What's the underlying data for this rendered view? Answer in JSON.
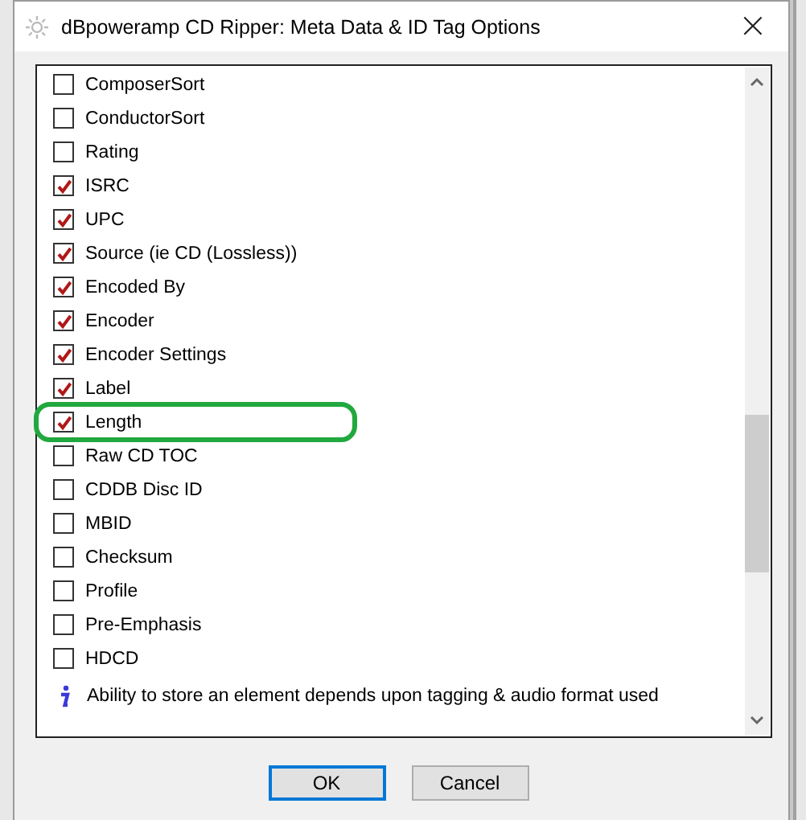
{
  "window": {
    "title": "dBpoweramp CD Ripper: Meta Data & ID Tag Options",
    "close": "×"
  },
  "items": [
    {
      "label": "ComposerSort",
      "checked": false,
      "highlighted": false
    },
    {
      "label": "ConductorSort",
      "checked": false,
      "highlighted": false
    },
    {
      "label": "Rating",
      "checked": false,
      "highlighted": false
    },
    {
      "label": "ISRC",
      "checked": true,
      "highlighted": false
    },
    {
      "label": "UPC",
      "checked": true,
      "highlighted": false
    },
    {
      "label": "Source (ie CD (Lossless))",
      "checked": true,
      "highlighted": false
    },
    {
      "label": "Encoded By",
      "checked": true,
      "highlighted": false
    },
    {
      "label": "Encoder",
      "checked": true,
      "highlighted": false
    },
    {
      "label": "Encoder Settings",
      "checked": true,
      "highlighted": false
    },
    {
      "label": "Label",
      "checked": true,
      "highlighted": false
    },
    {
      "label": "Length",
      "checked": true,
      "highlighted": true
    },
    {
      "label": "Raw CD TOC",
      "checked": false,
      "highlighted": false
    },
    {
      "label": "CDDB Disc ID",
      "checked": false,
      "highlighted": false
    },
    {
      "label": "MBID",
      "checked": false,
      "highlighted": false
    },
    {
      "label": "Checksum",
      "checked": false,
      "highlighted": false
    },
    {
      "label": "Profile",
      "checked": false,
      "highlighted": false
    },
    {
      "label": "Pre-Emphasis",
      "checked": false,
      "highlighted": false
    },
    {
      "label": "HDCD",
      "checked": false,
      "highlighted": false
    }
  ],
  "note": "Ability to store an element depends upon tagging & audio format used",
  "buttons": [
    {
      "label": "OK",
      "default": true
    },
    {
      "label": "Cancel",
      "default": false
    }
  ]
}
